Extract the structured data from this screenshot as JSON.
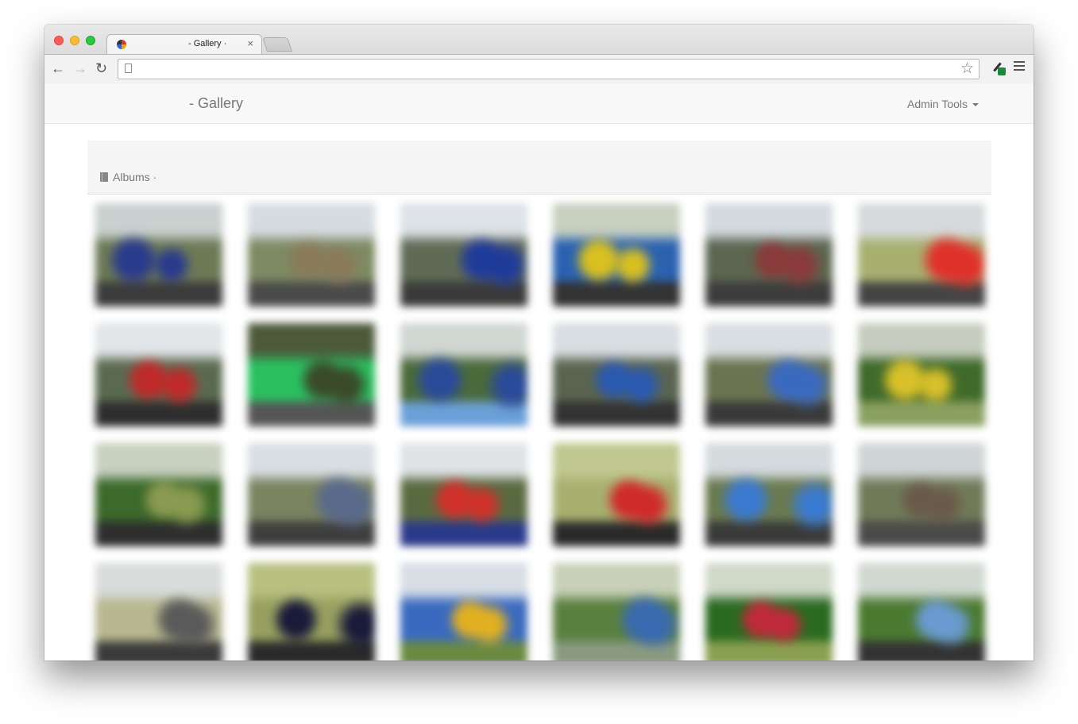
{
  "browser": {
    "tab_title": "- Gallery ·",
    "tab_close": "×",
    "icons": {
      "back": "arrow-left-icon",
      "forward": "arrow-right-icon",
      "reload": "reload-icon",
      "page": "page-icon",
      "bookmark": "star-icon",
      "extension": "eyedropper-extension-icon",
      "menu": "hamburger-menu-icon"
    },
    "glyphs": {
      "back": "←",
      "forward": "→",
      "reload": "↻",
      "star": "☆"
    }
  },
  "navbar": {
    "brand": "- Gallery",
    "admin_menu": "Admin Tools"
  },
  "breadcrumb": {
    "label": "Albums",
    "separator": "·"
  },
  "colors": {
    "accent_green": "#1a8a3a",
    "navbar_bg": "#f8f8f8",
    "jumbotron_bg": "#f5f5f5"
  }
}
